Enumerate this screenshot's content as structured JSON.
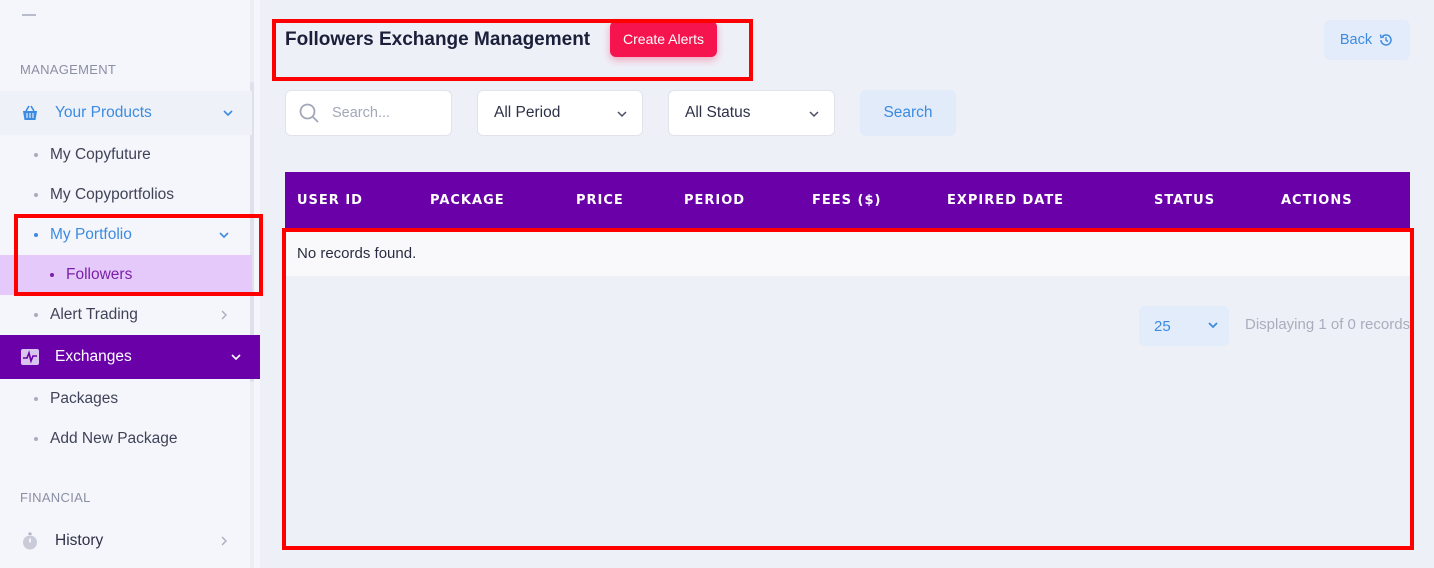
{
  "sidebar": {
    "sections": [
      {
        "label": "MANAGEMENT"
      },
      {
        "label": "FINANCIAL"
      }
    ],
    "items": {
      "your_products": "Your Products",
      "my_copyfuture": "My Copyfuture",
      "my_copyportfolios": "My Copyportfolios",
      "my_portfolio": "My Portfolio",
      "followers": "Followers",
      "alert_trading": "Alert Trading",
      "exchanges": "Exchanges",
      "packages": "Packages",
      "add_new_package": "Add New Package",
      "history": "History"
    },
    "colors": {
      "active_blue": "#3c8be0",
      "exchanges_bg": "#6a00a8",
      "followers_bg": "#e6c9fb",
      "followers_text": "#7a1fa8"
    }
  },
  "header": {
    "title": "Followers Exchange Management",
    "create_alerts_label": "Create Alerts",
    "back_label": "Back"
  },
  "filters": {
    "search_placeholder": "Search...",
    "period_value": "All Period",
    "status_value": "All Status",
    "search_button": "Search"
  },
  "table": {
    "columns": [
      "USER ID",
      "PACKAGE",
      "PRICE",
      "PERIOD",
      "FEES ($)",
      "EXPIRED DATE",
      "STATUS",
      "ACTIONS"
    ],
    "empty_message": "No records found.",
    "header_color": "#6a00a8"
  },
  "pagination": {
    "page_size": "25",
    "display_text": "Displaying 1 of 0 records"
  }
}
